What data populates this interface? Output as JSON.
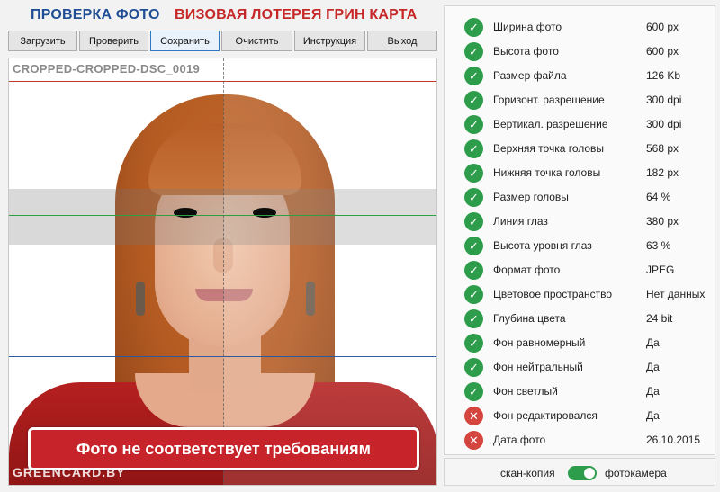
{
  "header": {
    "title_check": "ПРОВЕРКА ФОТО",
    "title_lottery": "ВИЗОВАЯ ЛОТЕРЕЯ ГРИН КАРТА"
  },
  "toolbar": {
    "buttons": [
      "Загрузить",
      "Проверить",
      "Сохранить",
      "Очистить",
      "Инструкция",
      "Выход"
    ]
  },
  "photo": {
    "filename": "CROPPED-CROPPED-DSC_0019",
    "verdict": "Фото не соответствует требованиям",
    "watermark": "GREENCARD.BY"
  },
  "checks": [
    {
      "label": "Ширина фото",
      "value": "600 px",
      "status": "ok"
    },
    {
      "label": "Высота фото",
      "value": "600 px",
      "status": "ok"
    },
    {
      "label": "Размер файла",
      "value": "126 Kb",
      "status": "ok"
    },
    {
      "label": "Горизонт. разрешение",
      "value": "300 dpi",
      "status": "ok"
    },
    {
      "label": "Вертикал. разрешение",
      "value": "300 dpi",
      "status": "ok"
    },
    {
      "label": "Верхняя точка головы",
      "value": "568 px",
      "status": "ok"
    },
    {
      "label": "Нижняя точка головы",
      "value": "182 px",
      "status": "ok"
    },
    {
      "label": "Размер головы",
      "value": "64 %",
      "status": "ok"
    },
    {
      "label": "Линия глаз",
      "value": "380 px",
      "status": "ok"
    },
    {
      "label": "Высота уровня глаз",
      "value": "63 %",
      "status": "ok"
    },
    {
      "label": "Формат фото",
      "value": "JPEG",
      "status": "ok"
    },
    {
      "label": "Цветовое пространство",
      "value": "Нет данных",
      "status": "ok"
    },
    {
      "label": "Глубина цвета",
      "value": "24 bit",
      "status": "ok"
    },
    {
      "label": "Фон равномерный",
      "value": "Да",
      "status": "ok"
    },
    {
      "label": "Фон нейтральный",
      "value": "Да",
      "status": "ok"
    },
    {
      "label": "Фон светлый",
      "value": "Да",
      "status": "ok"
    },
    {
      "label": "Фон редактировался",
      "value": "Да",
      "status": "bad"
    },
    {
      "label": "Дата фото",
      "value": "26.10.2015",
      "status": "bad"
    }
  ],
  "mode": {
    "left_label": "скан-копия",
    "right_label": "фотокамера",
    "toggle_on": true
  },
  "colors": {
    "ok": "#2e9d4b",
    "bad": "#d5453f",
    "verdict_bg": "#c7232a",
    "title_blue": "#1f4e96",
    "title_red": "#c62828"
  }
}
